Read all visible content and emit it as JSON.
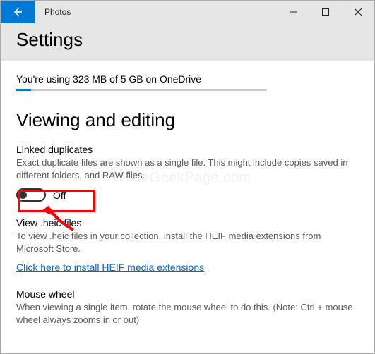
{
  "titlebar": {
    "app_title": "Photos"
  },
  "header": {
    "title": "Settings"
  },
  "storage": {
    "text": "You're using 323 MB of 5 GB on OneDrive",
    "fill_percent": 6
  },
  "section": {
    "heading": "Viewing and editing",
    "linked_dup": {
      "title": "Linked duplicates",
      "desc": "Exact duplicate files are shown as a single file. This might include copies saved in different folders, and RAW files.",
      "toggle_state": "Off"
    },
    "heic": {
      "title": "View .heic files",
      "desc": "To view .heic files in your collection, install the HEIF media extensions from Microsoft Store.",
      "link": "Click here to install HEIF media extensions"
    },
    "mouse": {
      "title": "Mouse wheel",
      "desc": "When viewing a single item, rotate the mouse wheel to do this. (Note: Ctrl + mouse wheel always zooms in or out)"
    }
  },
  "watermark": "TheGeekPage.com"
}
